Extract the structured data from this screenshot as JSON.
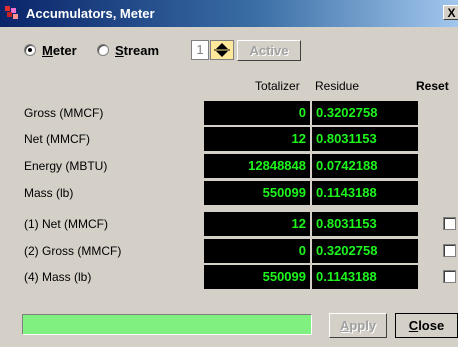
{
  "window": {
    "title": "Accumulators, Meter",
    "close_glyph": "X"
  },
  "mode": {
    "meter_label_u": "M",
    "meter_label_rest": "eter",
    "stream_label_u": "S",
    "stream_label_rest": "tream",
    "selected": "Meter",
    "stream_number": "1",
    "active_label": "Active"
  },
  "table": {
    "headers": {
      "totalizer": "Totalizer",
      "residue": "Residue",
      "reset": "Reset"
    },
    "rows": [
      {
        "label": "Gross (MMCF)",
        "totalizer": "0",
        "residue": "0.3202758"
      },
      {
        "label": "Net (MMCF)",
        "totalizer": "12",
        "residue": "0.8031153"
      },
      {
        "label": "Energy (MBTU)",
        "totalizer": "12848848",
        "residue": "0.0742188"
      },
      {
        "label": "Mass (lb)",
        "totalizer": "550099",
        "residue": "0.1143188"
      },
      {
        "label": "(1) Net (MMCF)",
        "totalizer": "12",
        "residue": "0.8031153"
      },
      {
        "label": "(2) Gross (MMCF)",
        "totalizer": "0",
        "residue": "0.3202758"
      },
      {
        "label": "(4) Mass (lb)",
        "totalizer": "550099",
        "residue": "0.1143188"
      }
    ]
  },
  "footer": {
    "progress_fraction": 1.0,
    "apply_label_u": "A",
    "apply_label_rest": "pply",
    "close_label_u": "C",
    "close_label_rest": "lose"
  },
  "colors": {
    "value_text": "#1df51d",
    "value_bg": "#000000",
    "progress": "#80f080",
    "title_bar": "#0a246a"
  }
}
